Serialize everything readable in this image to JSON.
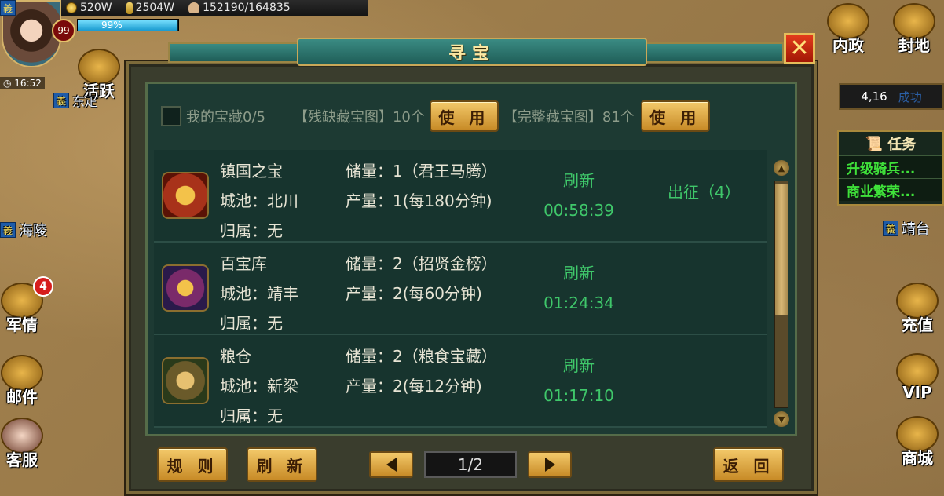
{
  "hud": {
    "gold": "520W",
    "grain": "2504W",
    "population": "152190/164835",
    "level": "99",
    "energy_percent": "99%",
    "time": "16:52",
    "nation_flag": "義"
  },
  "left_menu": {
    "activity": "活跃",
    "military": "军情",
    "military_badge": "4",
    "mail": "邮件",
    "service": "客服"
  },
  "map_labels": {
    "dongting": "东疋",
    "hailing": "海陵",
    "jingtai": "靖台"
  },
  "right_menu": {
    "politics": "内政",
    "fief": "封地",
    "coord": "4,16",
    "coord_extra": "成功",
    "recharge": "充值",
    "vip": "VIP",
    "mall": "商城"
  },
  "tasks": {
    "title": "任务",
    "items": [
      "升级骑兵...",
      "商业繁荣..."
    ]
  },
  "dialog": {
    "title": "寻宝",
    "close": "✕",
    "my_treasure": "我的宝藏0/5",
    "broken_map": "【残缺藏宝图】10个",
    "complete_map": "【完整藏宝图】81个",
    "use_label": "使 用",
    "rows": [
      {
        "name": "镇国之宝",
        "city": "城池：北川",
        "owner": "归属：无",
        "stock": "储量：1（君王马腾）",
        "output": "产量：1(每180分钟)",
        "refresh_label": "刷新",
        "refresh_time": "00:58:39",
        "action": "出征（4）"
      },
      {
        "name": "百宝库",
        "city": "城池：靖丰",
        "owner": "归属：无",
        "stock": "储量：2（招贤金榜）",
        "output": "产量：2(每60分钟)",
        "refresh_label": "刷新",
        "refresh_time": "01:24:34",
        "action": ""
      },
      {
        "name": "粮仓",
        "city": "城池：新梁",
        "owner": "归属：无",
        "stock": "储量：2（粮食宝藏）",
        "output": "产量：2(每12分钟)",
        "refresh_label": "刷新",
        "refresh_time": "01:17:10",
        "action": ""
      }
    ],
    "rules_btn": "规 则",
    "refresh_btn": "刷 新",
    "page": "1/2",
    "back_btn": "返 回"
  },
  "colors": {
    "accent_gold": "#c78a26",
    "panel_green": "#1d3a33",
    "timer_green": "#3fc76a",
    "close_red": "#d22c10"
  }
}
